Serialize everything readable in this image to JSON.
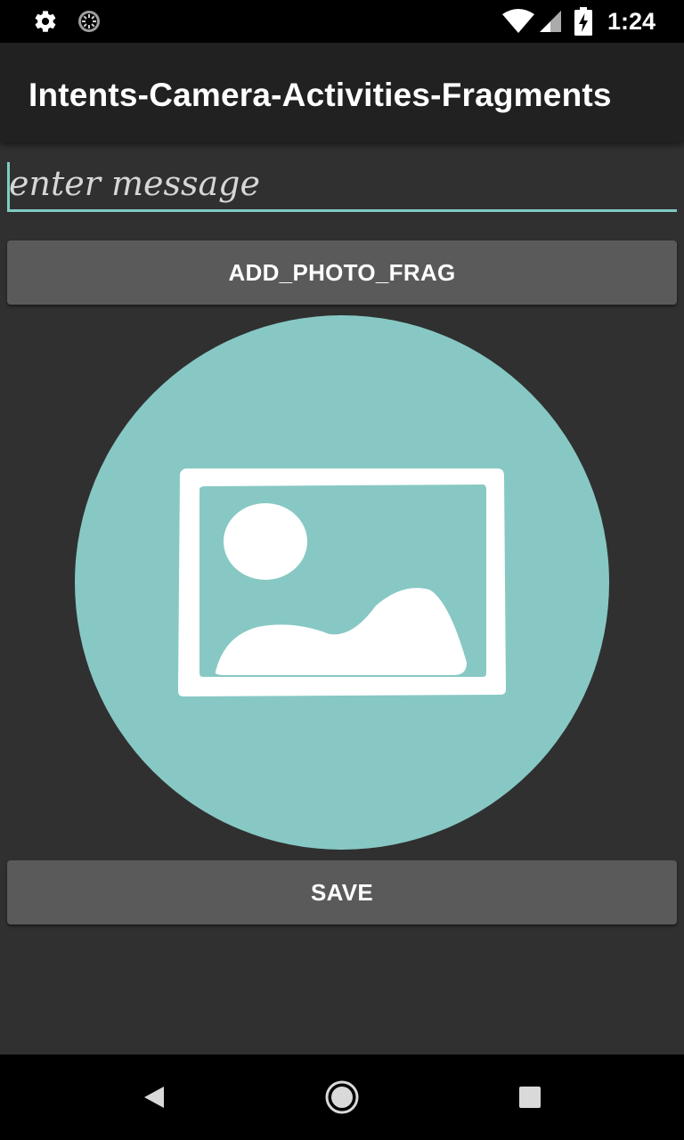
{
  "status_bar": {
    "time": "1:24",
    "icons": [
      "gear-icon",
      "sync-progress-icon",
      "wifi-icon",
      "cell-signal-icon",
      "battery-charging-icon"
    ]
  },
  "app_bar": {
    "title": "Intents-Camera-Activities-Fragments"
  },
  "message_input": {
    "placeholder": "enter message",
    "value": ""
  },
  "buttons": {
    "add_photo_label": "ADD_PHOTO_FRAG",
    "save_label": "SAVE"
  },
  "photo": {
    "icon": "image-placeholder-icon",
    "circle_color": "#87c8c4"
  },
  "nav_bar": {
    "icons": [
      "back-icon",
      "home-icon",
      "recents-icon"
    ]
  },
  "colors": {
    "accent": "#80cbc4",
    "background": "#303030",
    "app_bar": "#212121",
    "button": "#5a5a5b"
  }
}
